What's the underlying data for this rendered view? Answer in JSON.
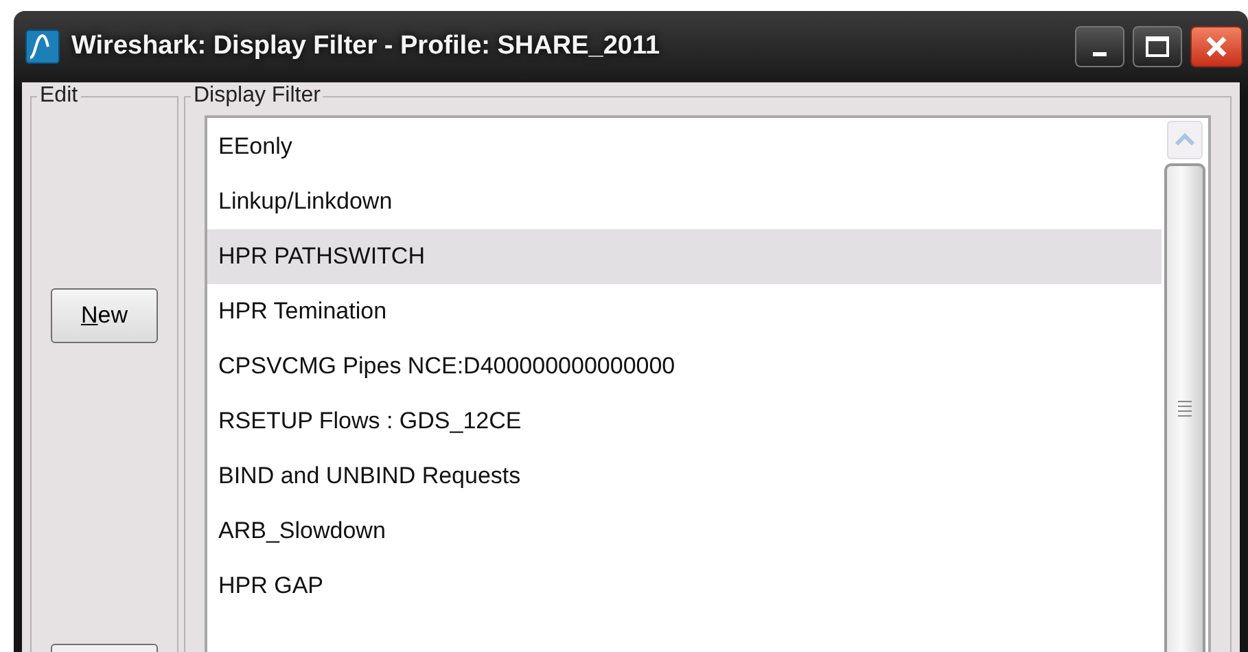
{
  "window": {
    "title": "Wireshark: Display Filter - Profile: SHARE_2011"
  },
  "edit_group": {
    "label": "Edit",
    "buttons": [
      {
        "label": "New",
        "mnemonic": true
      }
    ]
  },
  "filter_group": {
    "label": "Display Filter",
    "items": [
      {
        "label": "EEonly",
        "selected": false
      },
      {
        "label": "Linkup/Linkdown",
        "selected": false
      },
      {
        "label": "HPR PATHSWITCH",
        "selected": true
      },
      {
        "label": "HPR Temination",
        "selected": false
      },
      {
        "label": "CPSVCMG Pipes NCE:D400000000000000",
        "selected": false
      },
      {
        "label": "RSETUP Flows : GDS_12CE",
        "selected": false
      },
      {
        "label": "BIND and UNBIND Requests",
        "selected": false
      },
      {
        "label": "ARB_Slowdown",
        "selected": false
      },
      {
        "label": "HPR GAP",
        "selected": false
      }
    ]
  }
}
